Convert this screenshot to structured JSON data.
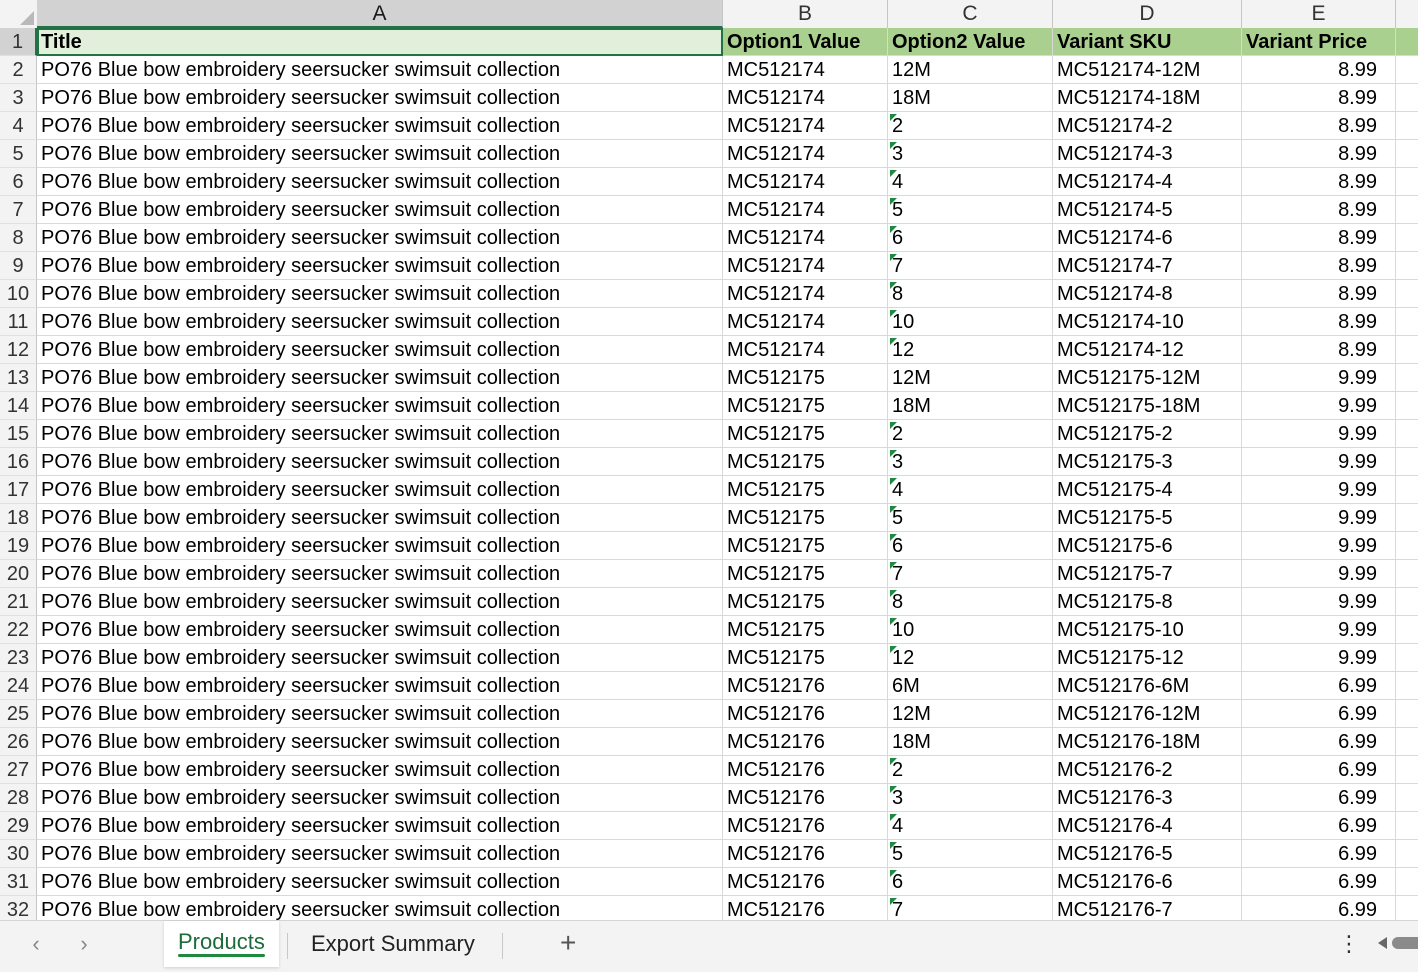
{
  "columns": [
    "A",
    "B",
    "C",
    "D",
    "E"
  ],
  "header": {
    "row_num": "1",
    "title": "Title",
    "option1": "Option1 Value",
    "option2": "Option2 Value",
    "sku": "Variant SKU",
    "price": "Variant Price"
  },
  "rows": [
    {
      "n": "2",
      "title": "PO76 Blue bow embroidery seersucker swimsuit collection",
      "opt1": "MC512174",
      "opt2": "12M",
      "sku": "MC512174-12M",
      "price": "8.99",
      "flag": false
    },
    {
      "n": "3",
      "title": "PO76 Blue bow embroidery seersucker swimsuit collection",
      "opt1": "MC512174",
      "opt2": "18M",
      "sku": "MC512174-18M",
      "price": "8.99",
      "flag": false
    },
    {
      "n": "4",
      "title": "PO76 Blue bow embroidery seersucker swimsuit collection",
      "opt1": "MC512174",
      "opt2": "2",
      "sku": "MC512174-2",
      "price": "8.99",
      "flag": true
    },
    {
      "n": "5",
      "title": "PO76 Blue bow embroidery seersucker swimsuit collection",
      "opt1": "MC512174",
      "opt2": "3",
      "sku": "MC512174-3",
      "price": "8.99",
      "flag": true
    },
    {
      "n": "6",
      "title": "PO76 Blue bow embroidery seersucker swimsuit collection",
      "opt1": "MC512174",
      "opt2": "4",
      "sku": "MC512174-4",
      "price": "8.99",
      "flag": true
    },
    {
      "n": "7",
      "title": "PO76 Blue bow embroidery seersucker swimsuit collection",
      "opt1": "MC512174",
      "opt2": "5",
      "sku": "MC512174-5",
      "price": "8.99",
      "flag": true
    },
    {
      "n": "8",
      "title": "PO76 Blue bow embroidery seersucker swimsuit collection",
      "opt1": "MC512174",
      "opt2": "6",
      "sku": "MC512174-6",
      "price": "8.99",
      "flag": true
    },
    {
      "n": "9",
      "title": "PO76 Blue bow embroidery seersucker swimsuit collection",
      "opt1": "MC512174",
      "opt2": "7",
      "sku": "MC512174-7",
      "price": "8.99",
      "flag": true
    },
    {
      "n": "10",
      "title": "PO76 Blue bow embroidery seersucker swimsuit collection",
      "opt1": "MC512174",
      "opt2": "8",
      "sku": "MC512174-8",
      "price": "8.99",
      "flag": true
    },
    {
      "n": "11",
      "title": "PO76 Blue bow embroidery seersucker swimsuit collection",
      "opt1": "MC512174",
      "opt2": "10",
      "sku": "MC512174-10",
      "price": "8.99",
      "flag": true
    },
    {
      "n": "12",
      "title": "PO76 Blue bow embroidery seersucker swimsuit collection",
      "opt1": "MC512174",
      "opt2": "12",
      "sku": "MC512174-12",
      "price": "8.99",
      "flag": true
    },
    {
      "n": "13",
      "title": "PO76 Blue bow embroidery seersucker swimsuit collection",
      "opt1": "MC512175",
      "opt2": "12M",
      "sku": "MC512175-12M",
      "price": "9.99",
      "flag": false
    },
    {
      "n": "14",
      "title": "PO76 Blue bow embroidery seersucker swimsuit collection",
      "opt1": "MC512175",
      "opt2": "18M",
      "sku": "MC512175-18M",
      "price": "9.99",
      "flag": false
    },
    {
      "n": "15",
      "title": "PO76 Blue bow embroidery seersucker swimsuit collection",
      "opt1": "MC512175",
      "opt2": "2",
      "sku": "MC512175-2",
      "price": "9.99",
      "flag": true
    },
    {
      "n": "16",
      "title": "PO76 Blue bow embroidery seersucker swimsuit collection",
      "opt1": "MC512175",
      "opt2": "3",
      "sku": "MC512175-3",
      "price": "9.99",
      "flag": true
    },
    {
      "n": "17",
      "title": "PO76 Blue bow embroidery seersucker swimsuit collection",
      "opt1": "MC512175",
      "opt2": "4",
      "sku": "MC512175-4",
      "price": "9.99",
      "flag": true
    },
    {
      "n": "18",
      "title": "PO76 Blue bow embroidery seersucker swimsuit collection",
      "opt1": "MC512175",
      "opt2": "5",
      "sku": "MC512175-5",
      "price": "9.99",
      "flag": true
    },
    {
      "n": "19",
      "title": "PO76 Blue bow embroidery seersucker swimsuit collection",
      "opt1": "MC512175",
      "opt2": "6",
      "sku": "MC512175-6",
      "price": "9.99",
      "flag": true
    },
    {
      "n": "20",
      "title": "PO76 Blue bow embroidery seersucker swimsuit collection",
      "opt1": "MC512175",
      "opt2": "7",
      "sku": "MC512175-7",
      "price": "9.99",
      "flag": true
    },
    {
      "n": "21",
      "title": "PO76 Blue bow embroidery seersucker swimsuit collection",
      "opt1": "MC512175",
      "opt2": "8",
      "sku": "MC512175-8",
      "price": "9.99",
      "flag": true
    },
    {
      "n": "22",
      "title": "PO76 Blue bow embroidery seersucker swimsuit collection",
      "opt1": "MC512175",
      "opt2": "10",
      "sku": "MC512175-10",
      "price": "9.99",
      "flag": true
    },
    {
      "n": "23",
      "title": "PO76 Blue bow embroidery seersucker swimsuit collection",
      "opt1": "MC512175",
      "opt2": "12",
      "sku": "MC512175-12",
      "price": "9.99",
      "flag": true
    },
    {
      "n": "24",
      "title": "PO76 Blue bow embroidery seersucker swimsuit collection",
      "opt1": "MC512176",
      "opt2": "6M",
      "sku": "MC512176-6M",
      "price": "6.99",
      "flag": false
    },
    {
      "n": "25",
      "title": "PO76 Blue bow embroidery seersucker swimsuit collection",
      "opt1": "MC512176",
      "opt2": "12M",
      "sku": "MC512176-12M",
      "price": "6.99",
      "flag": false
    },
    {
      "n": "26",
      "title": "PO76 Blue bow embroidery seersucker swimsuit collection",
      "opt1": "MC512176",
      "opt2": "18M",
      "sku": "MC512176-18M",
      "price": "6.99",
      "flag": false
    },
    {
      "n": "27",
      "title": "PO76 Blue bow embroidery seersucker swimsuit collection",
      "opt1": "MC512176",
      "opt2": "2",
      "sku": "MC512176-2",
      "price": "6.99",
      "flag": true
    },
    {
      "n": "28",
      "title": "PO76 Blue bow embroidery seersucker swimsuit collection",
      "opt1": "MC512176",
      "opt2": "3",
      "sku": "MC512176-3",
      "price": "6.99",
      "flag": true
    },
    {
      "n": "29",
      "title": "PO76 Blue bow embroidery seersucker swimsuit collection",
      "opt1": "MC512176",
      "opt2": "4",
      "sku": "MC512176-4",
      "price": "6.99",
      "flag": true
    },
    {
      "n": "30",
      "title": "PO76 Blue bow embroidery seersucker swimsuit collection",
      "opt1": "MC512176",
      "opt2": "5",
      "sku": "MC512176-5",
      "price": "6.99",
      "flag": true
    },
    {
      "n": "31",
      "title": "PO76 Blue bow embroidery seersucker swimsuit collection",
      "opt1": "MC512176",
      "opt2": "6",
      "sku": "MC512176-6",
      "price": "6.99",
      "flag": true
    },
    {
      "n": "32",
      "title": "PO76 Blue bow embroidery seersucker swimsuit collection",
      "opt1": "MC512176",
      "opt2": "7",
      "sku": "MC512176-7",
      "price": "6.99",
      "flag": true
    }
  ],
  "tabs": [
    {
      "label": "Products",
      "active": true
    },
    {
      "label": "Export Summary",
      "active": false
    }
  ],
  "icons": {
    "prev": "chevron-left-icon",
    "next": "chevron-right-icon",
    "add": "plus-icon",
    "menu": "more-vertical-icon"
  },
  "colors": {
    "header_fill": "#a9d08e",
    "title_header_fill": "#e2efda",
    "accent": "#217346"
  }
}
